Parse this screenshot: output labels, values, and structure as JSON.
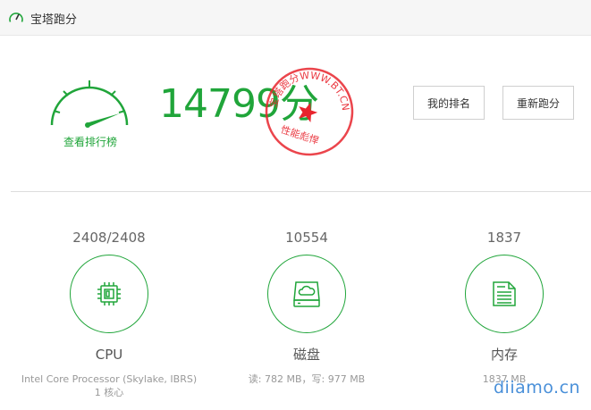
{
  "header": {
    "title": "宝塔跑分",
    "icon": "speedometer-icon"
  },
  "score": {
    "value": "14799",
    "unit": "分",
    "rank_link": "查看排行榜"
  },
  "stamp": {
    "top_text": "宝塔跑分WWW.BT.CN",
    "bottom_text": "性能彪悍",
    "color": "#e8242d"
  },
  "buttons": {
    "my_rank": "我的排名",
    "rerun": "重新跑分"
  },
  "stats": [
    {
      "value": "2408/2408",
      "name": "CPU",
      "detail": "Intel Core Processor (Skylake, IBRS) 1 核心",
      "icon": "cpu-chip-icon"
    },
    {
      "value": "10554",
      "name": "磁盘",
      "detail": "读: 782 MB，写: 977 MB",
      "icon": "disk-cloud-icon"
    },
    {
      "value": "1837",
      "name": "内存",
      "detail": "1837 MB",
      "icon": "memory-icon"
    }
  ],
  "watermark": "diiamo.cn",
  "colors": {
    "accent": "#20a53a",
    "stamp": "#e8242d",
    "watermark": "#4a90d9"
  }
}
